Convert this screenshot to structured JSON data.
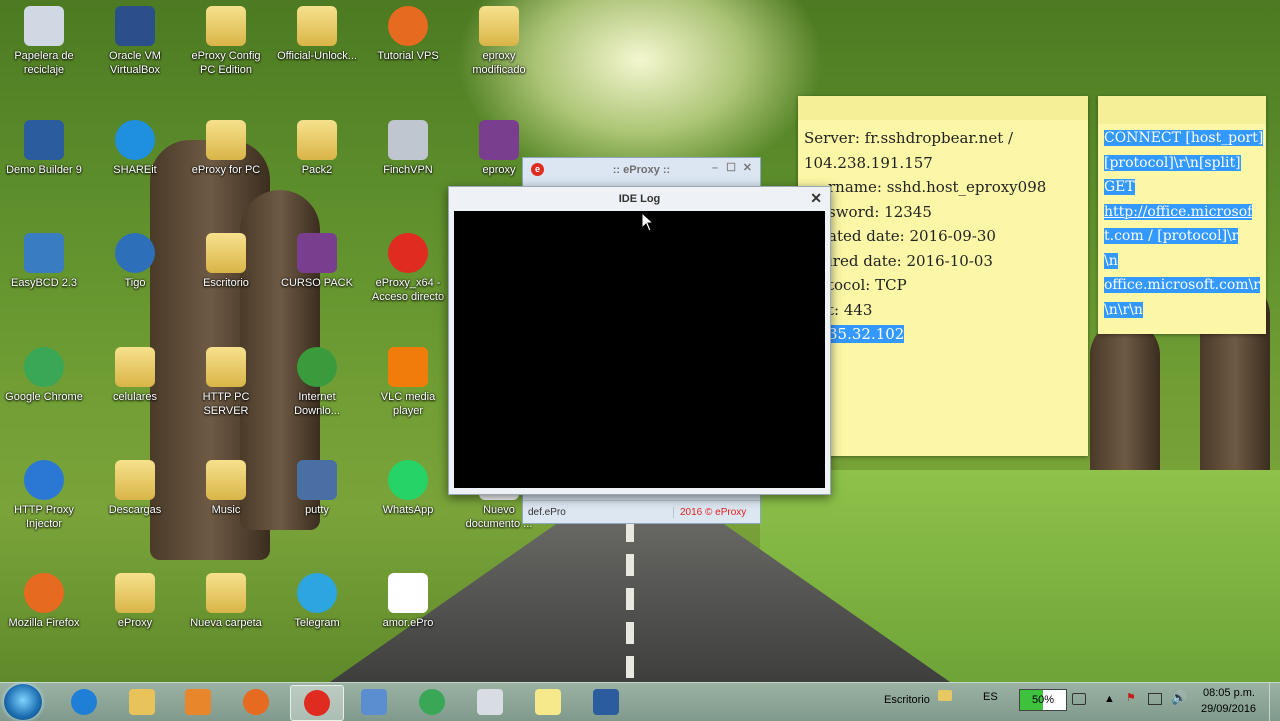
{
  "desktop": {
    "icons": [
      {
        "label": "Papelera de reciclaje",
        "icon": "recycle-bin-icon",
        "color": "#cfd8e3"
      },
      {
        "label": "Oracle VM VirtualBox",
        "icon": "virtualbox-icon",
        "color": "#2a4f8a"
      },
      {
        "label": "eProxy Config PC Edition",
        "icon": "folder-icon",
        "color": "#e8c862"
      },
      {
        "label": "Official-Unlock...",
        "icon": "folder-icon",
        "color": "#e8c862"
      },
      {
        "label": "Tutorial VPS",
        "icon": "firefox-doc-icon",
        "color": "#e66a1f"
      },
      {
        "label": "eproxy modificado",
        "icon": "folder-icon",
        "color": "#e8c862"
      },
      {
        "label": "Demo Builder 9",
        "icon": "clapper-icon",
        "color": "#2b5d9e"
      },
      {
        "label": "SHAREit",
        "icon": "shareit-icon",
        "color": "#1f8fe0"
      },
      {
        "label": "eProxy for PC",
        "icon": "folder-icon",
        "color": "#e8c862"
      },
      {
        "label": "Pack2",
        "icon": "folder-icon",
        "color": "#e8c862"
      },
      {
        "label": "FinchVPN",
        "icon": "finch-icon",
        "color": "#bfc6cf"
      },
      {
        "label": "eproxy",
        "icon": "winrar-icon",
        "color": "#7a3e8f"
      },
      {
        "label": "EasyBCD 2.3",
        "icon": "easybcd-icon",
        "color": "#3a7cc2"
      },
      {
        "label": "Tigo",
        "icon": "tigo-icon",
        "color": "#2d6fb8"
      },
      {
        "label": "Escritorio",
        "icon": "folder-icon",
        "color": "#e8c862"
      },
      {
        "label": "CURSO PACK",
        "icon": "winrar-icon",
        "color": "#7a3e8f"
      },
      {
        "label": "eProxy_x64 - Acceso directo",
        "icon": "eproxy-icon",
        "color": "#e02b20"
      },
      {
        "label": "Google Chrome",
        "icon": "chrome-icon",
        "color": "#3aa757"
      },
      {
        "label": "celulares",
        "icon": "folder-icon",
        "color": "#e8c862"
      },
      {
        "label": "HTTP PC SERVER",
        "icon": "folder-icon",
        "color": "#e8c862"
      },
      {
        "label": "Internet Downlo...",
        "icon": "idm-icon",
        "color": "#3a9b3c"
      },
      {
        "label": "VLC media player",
        "icon": "vlc-icon",
        "color": "#f07d0a"
      },
      {
        "label": "HTTP Proxy Injector",
        "icon": "globe-icon",
        "color": "#2a78d4"
      },
      {
        "label": "Descargas",
        "icon": "folder-icon",
        "color": "#e8c862"
      },
      {
        "label": "Music",
        "icon": "folder-icon",
        "color": "#e8c862"
      },
      {
        "label": "putty",
        "icon": "putty-icon",
        "color": "#4a6fa5"
      },
      {
        "label": "WhatsApp",
        "icon": "whatsapp-icon",
        "color": "#25d366"
      },
      {
        "label": "Nuevo documento ...",
        "icon": "text-file-icon",
        "color": "#ffffff"
      },
      {
        "label": "Mozilla Firefox",
        "icon": "firefox-icon",
        "color": "#e66a1f"
      },
      {
        "label": "eProxy",
        "icon": "folder-icon",
        "color": "#e8c862"
      },
      {
        "label": "Nueva carpeta",
        "icon": "folder-icon",
        "color": "#e8c862"
      },
      {
        "label": "Telegram",
        "icon": "telegram-icon",
        "color": "#2ca5e0"
      },
      {
        "label": "amor.ePro",
        "icon": "file-icon",
        "color": "#ffffff"
      }
    ]
  },
  "sticky_note_1": {
    "lines": [
      "Server: fr.sshdropbear.net /",
      "104.238.191.157",
      "",
      "rname: sshd.host_eproxy098",
      "sword: 12345",
      "ated date: 2016-09-30",
      "ired date: 2016-10-03",
      "tocol: TCP",
      "t: 443",
      "35.32.102"
    ]
  },
  "sticky_note_2": {
    "lines": [
      "CONNECT [host_port]",
      "[protocol]\\r\\n[split]",
      "GET",
      "http://office.microsof",
      "t.com / [protocol]\\r",
      "\\n",
      "office.microsoft.com\\r",
      "\\n\\r\\n"
    ]
  },
  "eproxy_window": {
    "title": ":: eProxy ::",
    "status_file": "def.ePro",
    "status_copyright": "2016 © eProxy",
    "copyright_color": "#e02020"
  },
  "ide_log_window": {
    "title": "IDE Log",
    "close_glyph": "✕"
  },
  "taskbar": {
    "pinned": [
      {
        "icon": "ie-icon",
        "color": "#1f7fd6"
      },
      {
        "icon": "explorer-icon",
        "color": "#e7c35a"
      },
      {
        "icon": "media-player-icon",
        "color": "#e8862b"
      },
      {
        "icon": "firefox-icon",
        "color": "#e66a1f"
      },
      {
        "icon": "eproxy-icon",
        "color": "#e02b20"
      },
      {
        "icon": "control-panel-icon",
        "color": "#5b8ed1"
      },
      {
        "icon": "chrome-icon",
        "color": "#3aa757"
      },
      {
        "icon": "finch-icon",
        "color": "#d8dde3"
      },
      {
        "icon": "sticky-notes-icon",
        "color": "#f5e98a"
      },
      {
        "icon": "clapper-icon",
        "color": "#2b5d9e"
      }
    ],
    "toolbar_label": "Escritorio",
    "language": "ES",
    "battery_percent": "50%",
    "time": "08:05 p.m.",
    "date": "29/09/2016"
  }
}
